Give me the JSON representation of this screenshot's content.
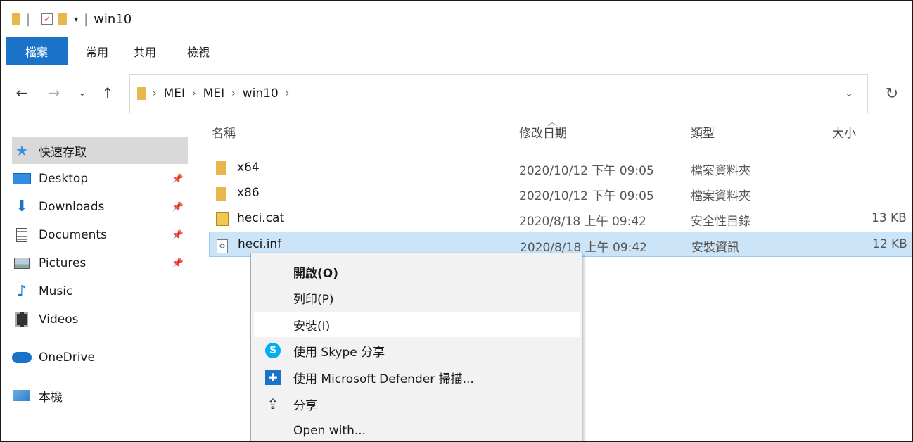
{
  "titlebar": {
    "title": "win10"
  },
  "ribbon": {
    "tabs": [
      "檔案",
      "常用",
      "共用",
      "檢視"
    ]
  },
  "address": {
    "crumbs": [
      "MEI",
      "MEI",
      "win10"
    ]
  },
  "sidebar": {
    "items": [
      {
        "label": "快速存取"
      },
      {
        "label": "Desktop"
      },
      {
        "label": "Downloads"
      },
      {
        "label": "Documents"
      },
      {
        "label": "Pictures"
      },
      {
        "label": "Music"
      },
      {
        "label": "Videos"
      },
      {
        "label": "OneDrive"
      },
      {
        "label": "本機"
      }
    ]
  },
  "columns": {
    "name": "名稱",
    "date": "修改日期",
    "type": "類型",
    "size": "大小"
  },
  "files": [
    {
      "name": "x64",
      "date": "2020/10/12 下午 09:05",
      "type": "檔案資料夾",
      "size": ""
    },
    {
      "name": "x86",
      "date": "2020/10/12 下午 09:05",
      "type": "檔案資料夾",
      "size": ""
    },
    {
      "name": "heci.cat",
      "date": "2020/8/18 上午 09:42",
      "type": "安全性目錄",
      "size": "13 KB"
    },
    {
      "name": "heci.inf",
      "date": "2020/8/18 上午 09:42",
      "type": "安裝資訊",
      "size": "12 KB"
    }
  ],
  "context_menu": {
    "items": [
      {
        "label": "開啟(O)"
      },
      {
        "label": "列印(P)"
      },
      {
        "label": "安裝(I)"
      },
      {
        "label": "使用 Skype 分享"
      },
      {
        "label": "使用 Microsoft Defender 掃描..."
      },
      {
        "label": "分享"
      },
      {
        "label": "Open with..."
      }
    ]
  },
  "colors": {
    "accent": "#1a73c8",
    "selection": "#cce4f7",
    "folder": "#e8b74b"
  }
}
